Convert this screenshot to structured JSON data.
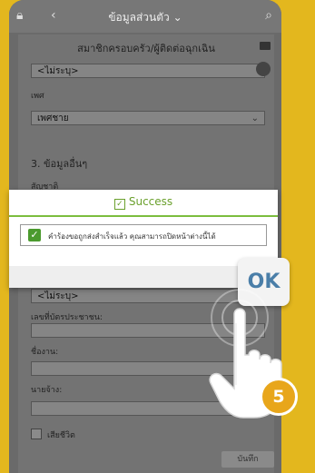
{
  "header": {
    "title": "ข้อมูลส่วนตัว"
  },
  "form": {
    "section_title": "สมาชิกครอบครัว/ผู้ติดต่อฉุกเฉิน",
    "dropdown1_value": "<ไม่ระบุ>",
    "gender_label": "เพศ",
    "gender_value": "เพศชาย",
    "section3_title": "3. ข้อมูลอื่นๆ",
    "nationality_label": "สัญชาติ",
    "dropdown2_value": "<ไม่ระบุ>",
    "id_label": "เลขที่บัตรประชาชน:",
    "work_label": "ชื่องาน:",
    "employer_label": "นายจ้าง:",
    "deceased_label": "เสียชีวิต",
    "save_label": "บันทึก"
  },
  "popup": {
    "title": "Success",
    "message": "คำร้องขอถูกส่งสำเร็จแล้ว คุณสามารถปิดหน้าต่างนี้ได้",
    "ok_label": "OK"
  },
  "tutorial": {
    "step": "5"
  }
}
